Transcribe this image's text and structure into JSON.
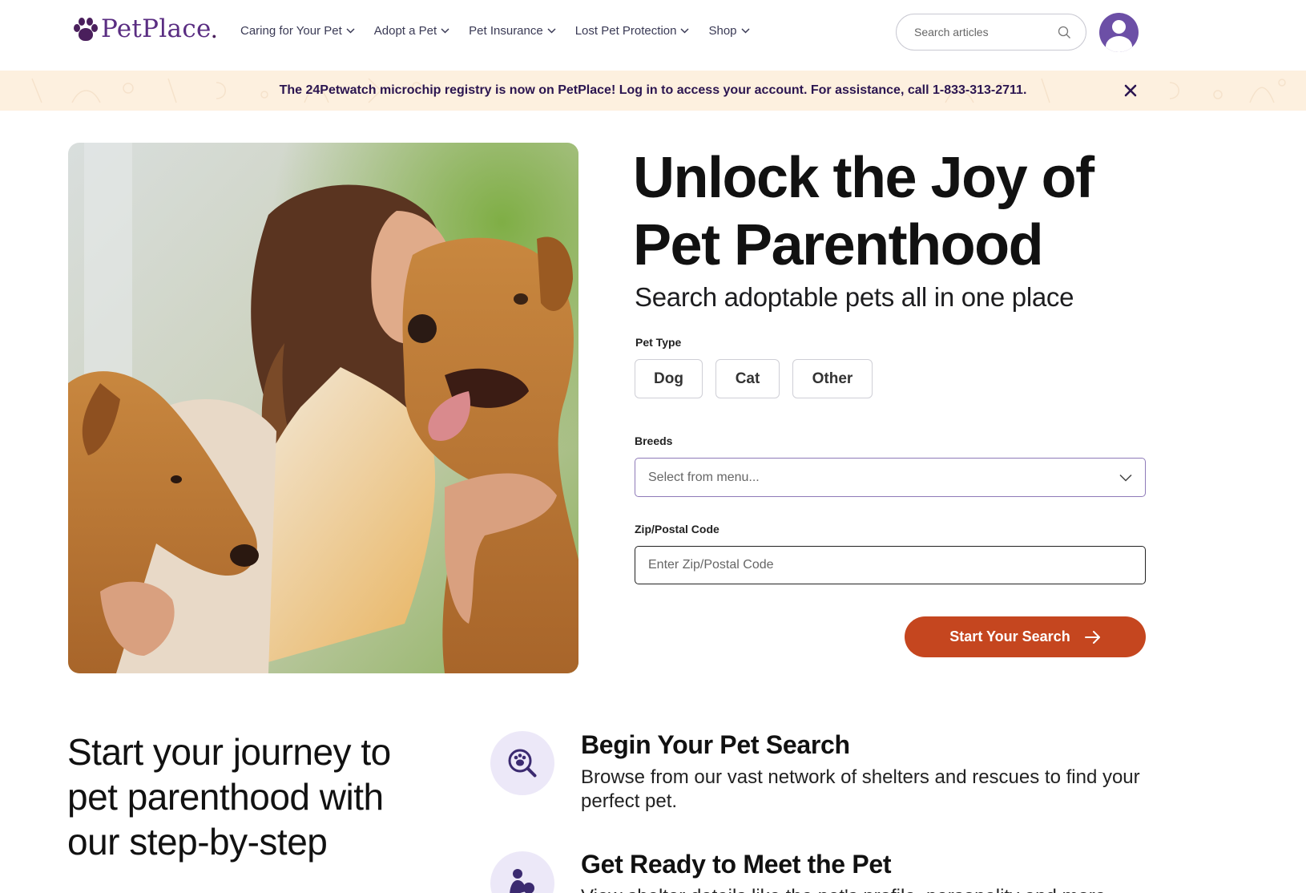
{
  "header": {
    "logo_text": "PetPlace",
    "nav": [
      {
        "label": "Caring for Your Pet"
      },
      {
        "label": "Adopt a Pet"
      },
      {
        "label": "Pet Insurance"
      },
      {
        "label": "Lost Pet Protection"
      },
      {
        "label": "Shop"
      }
    ],
    "search_placeholder": "Search articles"
  },
  "banner": {
    "text": "The 24Petwatch microchip registry is now on PetPlace! Log in to access your account. For assistance, call 1-833-313-2711."
  },
  "hero": {
    "title": "Unlock the Joy of Pet Parenthood",
    "subtitle": "Search adoptable pets all in one place",
    "pet_type_label": "Pet Type",
    "pet_types": [
      "Dog",
      "Cat",
      "Other"
    ],
    "breeds_label": "Breeds",
    "breeds_placeholder": "Select from menu...",
    "zip_label": "Zip/Postal Code",
    "zip_placeholder": "Enter Zip/Postal Code",
    "cta_label": "Start Your Search"
  },
  "journey": {
    "heading": "Start your journey to pet parenthood with our step-by-step",
    "steps": [
      {
        "title": "Begin Your Pet Search",
        "description": "Browse from our vast network of shelters and rescues to find your perfect pet.",
        "icon": "paw-search-icon"
      },
      {
        "title": "Get Ready to Meet the Pet",
        "description": "View shelter details like the pet's profile, personality and more.",
        "icon": "meet-pet-icon"
      }
    ]
  },
  "colors": {
    "brand_purple": "#5a2d82",
    "banner_bg": "#fdf0df",
    "cta": "#c5461f",
    "icon_bg": "#ece8f8"
  }
}
